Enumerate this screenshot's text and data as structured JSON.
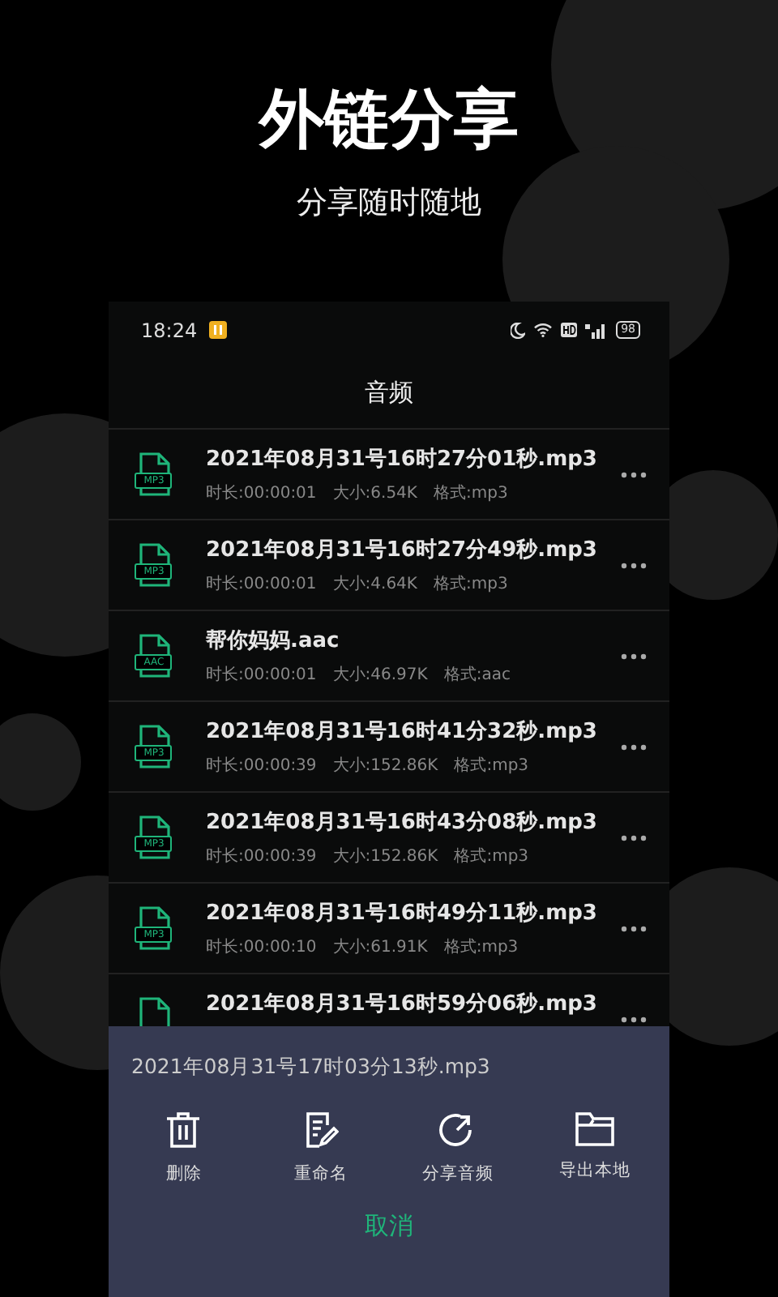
{
  "promo": {
    "title": "外链分享",
    "subtitle": "分享随时随地"
  },
  "status_bar": {
    "time": "18:24",
    "battery": "98"
  },
  "header": {
    "title": "音频"
  },
  "files": [
    {
      "icon_label": "MP3",
      "name": "2021年08月31号16时27分01秒.mp3",
      "duration": "时长:00:00:01",
      "size": "大小:6.54K",
      "format": "格式:mp3"
    },
    {
      "icon_label": "MP3",
      "name": "2021年08月31号16时27分49秒.mp3",
      "duration": "时长:00:00:01",
      "size": "大小:4.64K",
      "format": "格式:mp3"
    },
    {
      "icon_label": "AAC",
      "name": "帮你妈妈.aac",
      "duration": "时长:00:00:01",
      "size": "大小:46.97K",
      "format": "格式:aac"
    },
    {
      "icon_label": "MP3",
      "name": "2021年08月31号16时41分32秒.mp3",
      "duration": "时长:00:00:39",
      "size": "大小:152.86K",
      "format": "格式:mp3"
    },
    {
      "icon_label": "MP3",
      "name": "2021年08月31号16时43分08秒.mp3",
      "duration": "时长:00:00:39",
      "size": "大小:152.86K",
      "format": "格式:mp3"
    },
    {
      "icon_label": "MP3",
      "name": "2021年08月31号16时49分11秒.mp3",
      "duration": "时长:00:00:10",
      "size": "大小:61.91K",
      "format": "格式:mp3"
    },
    {
      "name": "2021年08月31号16时59分06秒.mp3"
    }
  ],
  "action_sheet": {
    "file_name": "2021年08月31号17时03分13秒.mp3",
    "actions": [
      {
        "kind": "delete",
        "label": "删除"
      },
      {
        "kind": "rename",
        "label": "重命名"
      },
      {
        "kind": "share",
        "label": "分享音频"
      },
      {
        "kind": "export",
        "label": "导出本地"
      }
    ],
    "cancel": "取消"
  }
}
